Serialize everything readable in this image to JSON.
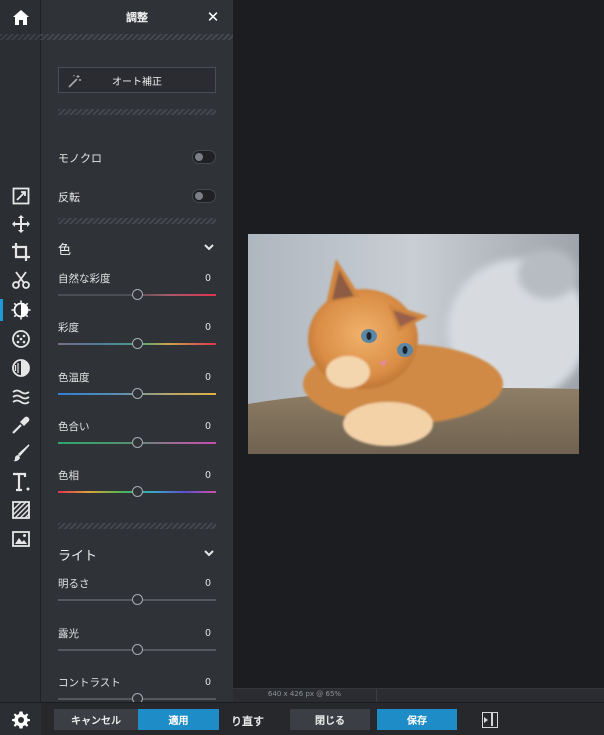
{
  "panel": {
    "title": "調整",
    "auto_label": "オート補正",
    "monochrome_label": "モノクロ",
    "invert_label": "反転",
    "color_section": "色",
    "light_section": "ライト",
    "color_sliders": [
      {
        "label": "自然な彩度",
        "value": "0",
        "position": 0.5,
        "track": "linear-gradient(90deg,#4a4d53 0%,#4a4d53 45%,#a65a6b 70%,#e0344f 100%)"
      },
      {
        "label": "彩度",
        "value": "0",
        "position": 0.5,
        "track": "linear-gradient(90deg,#7a6b86 0%,#4f7fa0 30%,#4aa37c 50%,#c9a54a 70%,#e0344f 100%)"
      },
      {
        "label": "色温度",
        "value": "0",
        "position": 0.5,
        "track": "linear-gradient(90deg,#2e7fd6 0%,#5b8fb0 40%,#b8a56a 70%,#e0b040 100%)"
      },
      {
        "label": "色合い",
        "value": "0",
        "position": 0.5,
        "track": "linear-gradient(90deg,#2ea86a 0%,#54906e 45%,#a26a96 75%,#c44db2 100%)"
      },
      {
        "label": "色相",
        "value": "0",
        "position": 0.5,
        "track": "linear-gradient(90deg,#e0344f 0%,#d9a53a 20%,#4fb552 40%,#36a9c7 60%,#5b4fd0 80%,#d04fa6 100%)"
      }
    ],
    "light_sliders": [
      {
        "label": "明るさ",
        "value": "0",
        "position": 0.5
      },
      {
        "label": "露光",
        "value": "0",
        "position": 0.5
      },
      {
        "label": "コントラスト",
        "value": "0",
        "position": 0.5
      }
    ]
  },
  "canvas": {
    "status_text": "640 x 426 px @ 65%"
  },
  "bottombar": {
    "cancel_label": "キャンセル",
    "apply_label": "適用",
    "redo_label": "り直す",
    "close_label": "閉じる",
    "save_label": "保存"
  },
  "icons": {
    "home": "home-icon",
    "settings": "gear-icon",
    "close": "close-icon",
    "tools": [
      "edit-image-icon",
      "move-icon",
      "crop-icon",
      "cut-icon",
      "adjust-icon",
      "filter-icon",
      "vignette-icon",
      "liquify-icon",
      "clone-icon",
      "brush-icon",
      "text-icon",
      "texture-icon",
      "image-icon"
    ]
  },
  "colors": {
    "accent": "#1e8cc6",
    "panel_bg": "#2f3237",
    "canvas_bg": "#1c1d20"
  }
}
